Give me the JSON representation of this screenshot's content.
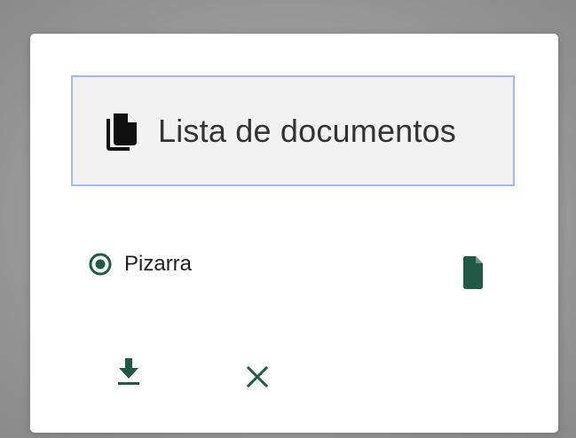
{
  "dialog": {
    "document_list_button": {
      "label": "Lista de documentos",
      "icon": "documents-copy-icon"
    },
    "option": {
      "label": "Pizarra",
      "selected": true,
      "icon": "radio-checked-icon"
    },
    "file_icon": "file-icon",
    "actions": {
      "download_icon": "download-icon",
      "close_icon": "close-icon"
    }
  },
  "colors": {
    "accent": "#1e5a45",
    "button_border": "#a9b6f5",
    "button_background": "#f2f2f2"
  }
}
